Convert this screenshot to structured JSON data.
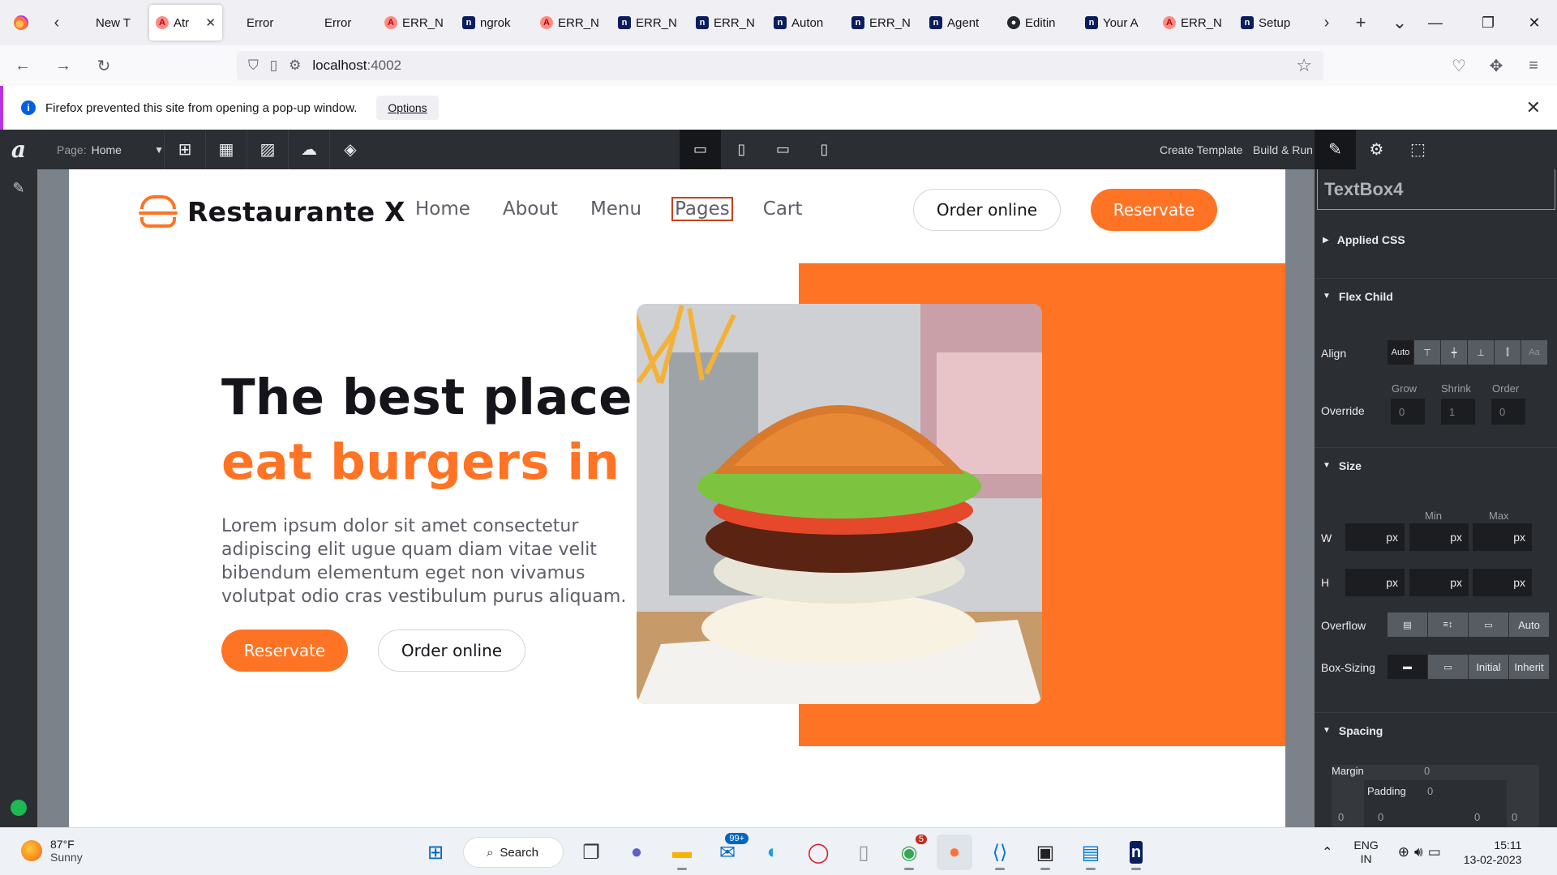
{
  "browser": {
    "tabs": [
      {
        "label": "New T",
        "favicon": "back-arrow-icon",
        "active": false
      },
      {
        "label": "Atr",
        "favicon": "astro-icon",
        "active": true
      },
      {
        "label": "Error",
        "favicon": "blank",
        "active": false
      },
      {
        "label": "Error",
        "favicon": "blank",
        "active": false
      },
      {
        "label": "ERR_N",
        "favicon": "astro-icon",
        "active": false
      },
      {
        "label": "ngrok",
        "favicon": "n-icon",
        "active": false
      },
      {
        "label": "ERR_N",
        "favicon": "astro-icon",
        "active": false
      },
      {
        "label": "ERR_N",
        "favicon": "n-icon",
        "active": false
      },
      {
        "label": "ERR_N",
        "favicon": "n-icon",
        "active": false
      },
      {
        "label": "Auton",
        "favicon": "n-icon",
        "active": false
      },
      {
        "label": "ERR_N",
        "favicon": "n-icon",
        "active": false
      },
      {
        "label": "Agent",
        "favicon": "n-icon",
        "active": false
      },
      {
        "label": "Editin",
        "favicon": "github-icon",
        "active": false
      },
      {
        "label": "Your A",
        "favicon": "n-icon",
        "active": false
      },
      {
        "label": "ERR_N",
        "favicon": "astro-icon",
        "active": false
      },
      {
        "label": "Setup",
        "favicon": "n-icon",
        "active": false
      }
    ],
    "url_host": "localhost",
    "url_port": ":4002",
    "popup_message": "Firefox prevented this site from opening a pop-up window.",
    "popup_options": "Options"
  },
  "editor": {
    "page_label": "Page:",
    "page_value": "Home",
    "create_template": "Create Template",
    "build_run": "Build & Run",
    "logo_letter": "a"
  },
  "site": {
    "name": "Restaurante X",
    "nav": [
      "Home",
      "About",
      "Menu",
      "Pages",
      "Cart"
    ],
    "order_online": "Order online",
    "reservate": "Reservate",
    "hero_title_1": "The best place to",
    "hero_title_2": "eat burgers in LA",
    "hero_text": "Lorem ipsum dolor sit amet consectetur adipiscing elit ugue quam diam vitae velit bibendum elementum eget non vivamus volutpat odio cras vestibulum purus aliquam.",
    "hero_btn_1": "Reservate",
    "hero_btn_2": "Order online",
    "accent_color": "#ff7324"
  },
  "props": {
    "selected": "TextBox4",
    "applied_css": "Applied CSS",
    "flex_child": "Flex Child",
    "align_label": "Align",
    "align_options": [
      "Auto",
      "top",
      "center",
      "bottom",
      "stretch",
      "Aa"
    ],
    "grow_label": "Grow",
    "shrink_label": "Shrink",
    "order_label": "Order",
    "override_label": "Override",
    "grow": "0",
    "shrink": "1",
    "order": "0",
    "size": "Size",
    "min": "Min",
    "max": "Max",
    "w": "W",
    "h": "H",
    "unit": "px",
    "overflow_label": "Overflow",
    "overflow_auto": "Auto",
    "box_sizing_label": "Box-Sizing",
    "initial": "Initial",
    "inherit": "Inherit",
    "spacing": "Spacing",
    "margin_label": "Margin",
    "margin": "0",
    "padding_label": "Padding",
    "padding": "0",
    "corner_values": [
      "0",
      "0",
      "0",
      "0"
    ]
  },
  "taskbar": {
    "temp": "87°F",
    "condition": "Sunny",
    "search": "Search",
    "mail_badge": "99+",
    "chrome_badge": "5",
    "lang1": "ENG",
    "lang2": "IN",
    "time": "15:11",
    "date": "13-02-2023"
  }
}
